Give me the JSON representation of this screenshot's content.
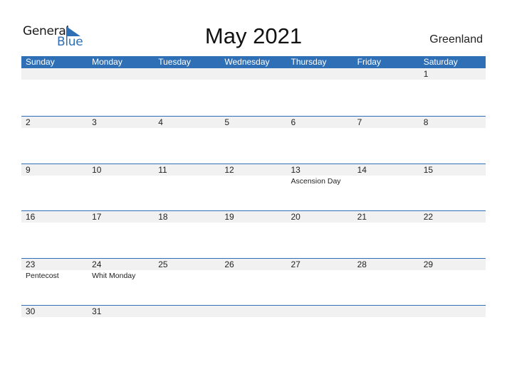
{
  "logo": {
    "line1": "General",
    "line2": "Blue",
    "accent_color": "#2e6fb5"
  },
  "header": {
    "title": "May 2021",
    "country": "Greenland"
  },
  "calendar": {
    "header_color": "#2e6fb5",
    "weekdays": [
      "Sunday",
      "Monday",
      "Tuesday",
      "Wednesday",
      "Thursday",
      "Friday",
      "Saturday"
    ],
    "weeks": [
      [
        {
          "day": ""
        },
        {
          "day": ""
        },
        {
          "day": ""
        },
        {
          "day": ""
        },
        {
          "day": ""
        },
        {
          "day": ""
        },
        {
          "day": "1"
        }
      ],
      [
        {
          "day": "2"
        },
        {
          "day": "3"
        },
        {
          "day": "4"
        },
        {
          "day": "5"
        },
        {
          "day": "6"
        },
        {
          "day": "7"
        },
        {
          "day": "8"
        }
      ],
      [
        {
          "day": "9"
        },
        {
          "day": "10"
        },
        {
          "day": "11"
        },
        {
          "day": "12"
        },
        {
          "day": "13",
          "holiday": "Ascension Day"
        },
        {
          "day": "14"
        },
        {
          "day": "15"
        }
      ],
      [
        {
          "day": "16"
        },
        {
          "day": "17"
        },
        {
          "day": "18"
        },
        {
          "day": "19"
        },
        {
          "day": "20"
        },
        {
          "day": "21"
        },
        {
          "day": "22"
        }
      ],
      [
        {
          "day": "23",
          "holiday": "Pentecost"
        },
        {
          "day": "24",
          "holiday": "Whit Monday"
        },
        {
          "day": "25"
        },
        {
          "day": "26"
        },
        {
          "day": "27"
        },
        {
          "day": "28"
        },
        {
          "day": "29"
        }
      ],
      [
        {
          "day": "30"
        },
        {
          "day": "31"
        },
        {
          "day": ""
        },
        {
          "day": ""
        },
        {
          "day": ""
        },
        {
          "day": ""
        },
        {
          "day": ""
        }
      ]
    ]
  }
}
